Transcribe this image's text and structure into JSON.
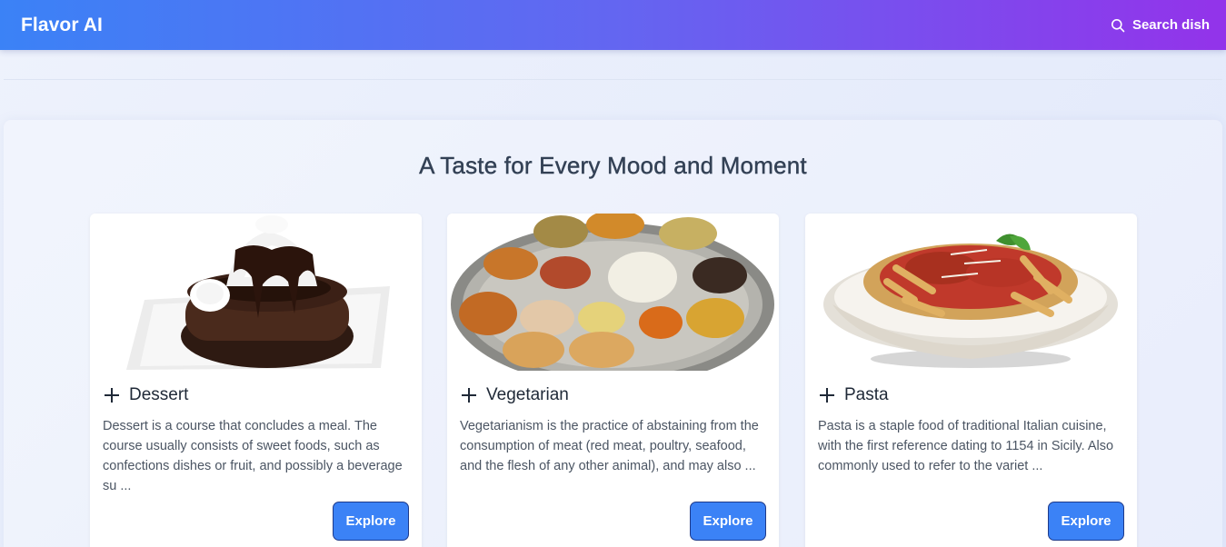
{
  "header": {
    "logo": "Flavor AI",
    "search_label": "Search dish"
  },
  "section": {
    "title": "A Taste for Every Mood and Moment"
  },
  "cards": [
    {
      "title": "Dessert",
      "description": "Dessert is a course that concludes a meal. The course usually consists of sweet foods, such as confections dishes or fruit, and possibly a beverage su ...",
      "button": "Explore"
    },
    {
      "title": "Vegetarian",
      "description": "Vegetarianism is the practice of abstaining from the consumption of meat (red meat, poultry, seafood, and the flesh of any other animal), and may also ...",
      "button": "Explore"
    },
    {
      "title": "Pasta",
      "description": "Pasta is a staple food of traditional Italian cuisine, with the first reference dating to 1154 in Sicily. Also commonly used to refer to the variet ...",
      "button": "Explore"
    }
  ],
  "colors": {
    "accent": "#3b82f6",
    "header_start": "#3b82f6",
    "header_end": "#9333ea"
  }
}
